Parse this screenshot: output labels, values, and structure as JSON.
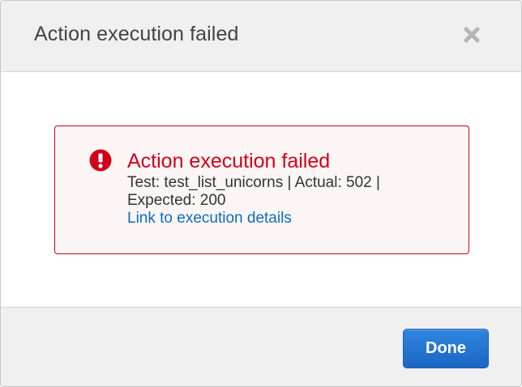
{
  "dialog": {
    "title": "Action execution failed",
    "close_icon": "close-icon"
  },
  "alert": {
    "icon": "exclamation-circle-icon",
    "title": "Action execution failed",
    "message": "Test: test_list_unicorns | Actual: 502 | Expected: 200",
    "link_text": "Link to execution details",
    "colors": {
      "border": "#d0021b",
      "title": "#d0021b",
      "background": "#fcf5f5",
      "link": "#0a6ebd"
    }
  },
  "footer": {
    "done_label": "Done",
    "done_color": "#1b66c4"
  }
}
